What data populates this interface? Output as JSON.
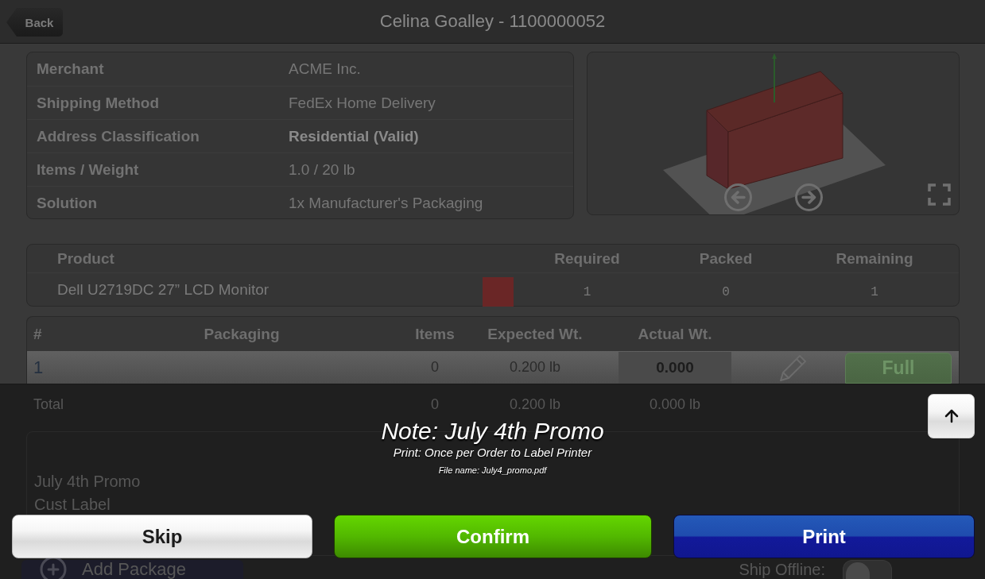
{
  "header": {
    "back": "Back",
    "title": "Celina Goalley - 1100000052"
  },
  "order_info": [
    {
      "label": "Merchant",
      "value": "ACME Inc.",
      "emphasized": false
    },
    {
      "label": "Shipping Method",
      "value": "FedEx Home Delivery",
      "emphasized": false
    },
    {
      "label": "Address Classification",
      "value": "Residential (Valid)",
      "emphasized": true
    },
    {
      "label": "Items / Weight",
      "value": "1.0 / 20 lb",
      "emphasized": false
    },
    {
      "label": "Solution",
      "value": "1x Manufacturer's Packaging",
      "emphasized": false
    }
  ],
  "products": {
    "columns": [
      "Product",
      "Required",
      "Packed",
      "Remaining"
    ],
    "rows": [
      {
        "name": "Dell U2719DC 27” LCD Monitor",
        "color": "#6a2626",
        "required": "1",
        "packed": "0",
        "remaining": "1"
      }
    ]
  },
  "packages": {
    "columns": [
      "#",
      "Packaging",
      "Items",
      "Expected Wt.",
      "Actual Wt."
    ],
    "rows": [
      {
        "number": "1",
        "items": "0",
        "expected": "0.200 lb",
        "actual": "0.000",
        "action": "Full",
        "selected": true
      }
    ],
    "total": {
      "label": "Total",
      "items": "0",
      "expected": "0.200 lb",
      "actual": "0.000 lb"
    }
  },
  "instructions": [
    "July 4th Promo",
    "Cust Label"
  ],
  "add_package": "Add Package",
  "ship_offline": {
    "label": "Ship Offline:",
    "on": false
  },
  "note": {
    "title": "Note: July 4th Promo",
    "print": "Print: Once per Order to Label Printer",
    "file": "File name: July4_promo.pdf"
  },
  "actions": [
    {
      "label": "Skip",
      "kind": "default"
    },
    {
      "label": "Confirm",
      "kind": "confirm"
    },
    {
      "label": "Print",
      "kind": "primary"
    }
  ]
}
